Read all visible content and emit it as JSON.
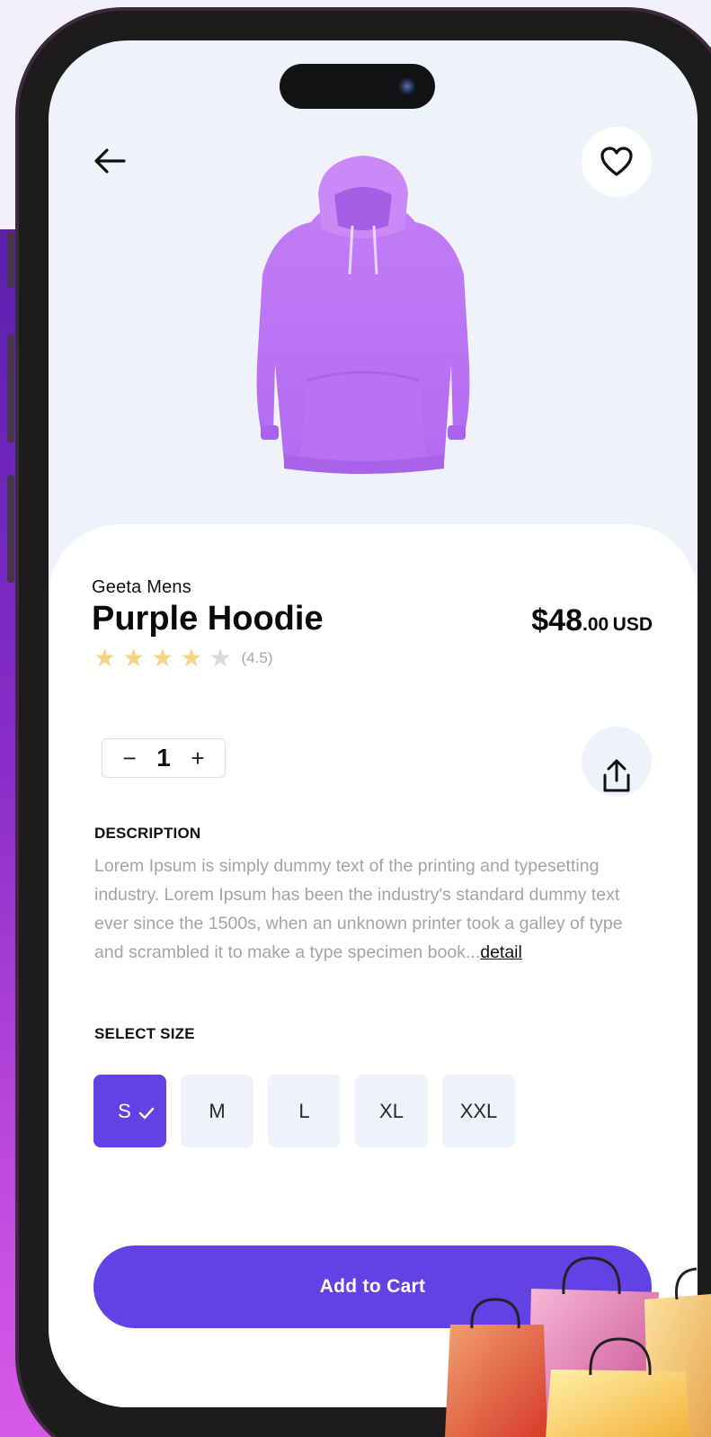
{
  "product": {
    "brand": "Geeta Mens",
    "title": "Purple Hoodie",
    "price_main": "$48",
    "price_cents": ".00",
    "currency": "USD",
    "rating": 4,
    "rating_text": "(4.5)",
    "image": "purple-hoodie"
  },
  "quantity": {
    "minus": "−",
    "value": "1",
    "plus": "+"
  },
  "description": {
    "label": "DESCRIPTION",
    "text": "Lorem Ipsum is simply dummy text of the printing and typesetting industry. Lorem Ipsum has been the industry's standard dummy text ever since the 1500s, when an unknown printer took a galley of type and scrambled it to make a type specimen book...",
    "link": "detail"
  },
  "sizes": {
    "label": "SELECT SIZE",
    "options": [
      "S",
      "M",
      "L",
      "XL",
      "XXL"
    ],
    "selected": "S"
  },
  "actions": {
    "add_to_cart": "Add to Cart"
  },
  "icons": {
    "back": "arrow-left-icon",
    "favorite": "heart-icon",
    "share": "share-icon",
    "check": "check-icon",
    "decoration": "shopping-bags"
  },
  "colors": {
    "accent": "#6342E5",
    "star": "#F8D28B",
    "background": "#EFF2FA"
  }
}
